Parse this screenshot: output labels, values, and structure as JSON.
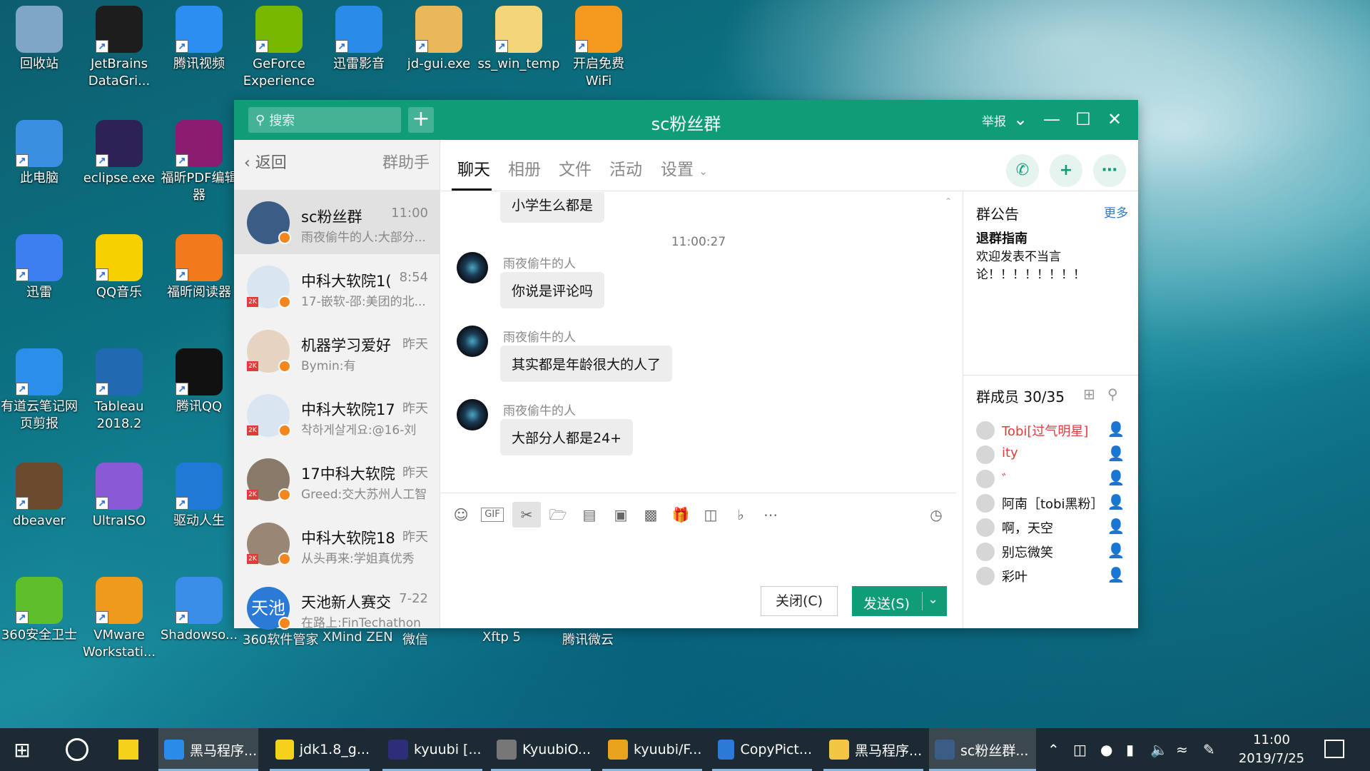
{
  "desktop": {
    "icons": [
      {
        "label": "回收站",
        "icon": "recycle-bin-icon",
        "color": "#7fa6c6"
      },
      {
        "label": "JetBrains DataGri...",
        "icon": "datagrip-icon",
        "color": "#1d1d1d"
      },
      {
        "label": "腾讯视频",
        "icon": "tencent-video-icon",
        "color": "#2b8ef0"
      },
      {
        "label": "GeForce Experience",
        "icon": "geforce-icon",
        "color": "#76b900"
      },
      {
        "label": "迅雷影音",
        "icon": "xunlei-player-icon",
        "color": "#2a8ce8"
      },
      {
        "label": "jd-gui.exe",
        "icon": "jd-gui-icon",
        "color": "#e9b85a"
      },
      {
        "label": "ss_win_temp",
        "icon": "folder-icon",
        "color": "#f3d57a"
      },
      {
        "label": "开启免费 WiFi",
        "icon": "wifi-icon",
        "color": "#f59a1c"
      },
      {
        "label": "此电脑",
        "icon": "this-pc-icon",
        "color": "#3a8fe0"
      },
      {
        "label": "eclipse.exe",
        "icon": "eclipse-icon",
        "color": "#2c2255"
      },
      {
        "label": "福昕PDF编辑器",
        "icon": "foxit-pdf-editor-icon",
        "color": "#8b1c6f"
      },
      {
        "label": "迅雷",
        "icon": "xunlei-icon",
        "color": "#3b7ff0"
      },
      {
        "label": "QQ音乐",
        "icon": "qq-music-icon",
        "color": "#f6d000"
      },
      {
        "label": "福昕阅读器",
        "icon": "foxit-reader-icon",
        "color": "#f07a1c"
      },
      {
        "label": "有道云笔记网 页剪报",
        "icon": "youdao-clipper-icon",
        "color": "#2a8fe8"
      },
      {
        "label": "Tableau 2018.2",
        "icon": "tableau-icon",
        "color": "#1f6ab0"
      },
      {
        "label": "腾讯QQ",
        "icon": "qq-penguin-icon",
        "color": "#111111"
      },
      {
        "label": "dbeaver",
        "icon": "dbeaver-icon",
        "color": "#6b4a2e"
      },
      {
        "label": "UltraISO",
        "icon": "ultraiso-icon",
        "color": "#8a5ad6"
      },
      {
        "label": "驱动人生",
        "icon": "driver-life-icon",
        "color": "#1f7ad6"
      },
      {
        "label": "360安全卫士",
        "icon": "360-safe-icon",
        "color": "#5fbf2a"
      },
      {
        "label": "VMware Workstati...",
        "icon": "vmware-icon",
        "color": "#f09a1c"
      },
      {
        "label": "Shadowso...",
        "icon": "shadowsocks-icon",
        "color": "#3a8ee8"
      }
    ],
    "hidden_labels": [
      "360软件管家",
      "XMind ZEN",
      "微信",
      "Xftp 5",
      "腾讯微云"
    ]
  },
  "window": {
    "title": "sc粉丝群",
    "search_placeholder": "搜索",
    "report": "举报",
    "back": "返回",
    "helper": "群助手",
    "tabs": [
      "聊天",
      "相册",
      "文件",
      "活动",
      "设置"
    ],
    "conversations": [
      {
        "name": "sc粉丝群",
        "time": "11:00",
        "preview": "雨夜偷牛的人:大部分...",
        "color": "#3b5c85",
        "badge": false
      },
      {
        "name": "中科大软院1(",
        "time": "8:54",
        "preview": "17-嵌软-邵:美团的北...",
        "color": "#d9e6f2",
        "badge": true
      },
      {
        "name": "机器学习爱好",
        "time": "昨天",
        "preview": "Bymin:有",
        "color": "#e6d3c0",
        "badge": true
      },
      {
        "name": "中科大软院17",
        "time": "昨天",
        "preview": "착하게살게요:@16-刘",
        "color": "#d9e6f2",
        "badge": true
      },
      {
        "name": "17中科大软院",
        "time": "昨天",
        "preview": "Greed:交大苏州人工智",
        "color": "#8a7a6a",
        "badge": true
      },
      {
        "name": "中科大软院18",
        "time": "昨天",
        "preview": "从头再来:学姐真优秀",
        "color": "#9a8674",
        "badge": true
      },
      {
        "name": "天池新人赛交",
        "time": "7-22",
        "preview": "在路上:FinTechathon",
        "color": "#2a7ad6",
        "badge": false,
        "avatar_text": "天池"
      }
    ],
    "messages": {
      "partial": "小学生么都是",
      "timestamp": "11:00:27",
      "items": [
        {
          "sender": "雨夜偷牛的人",
          "text": "你说是评论吗"
        },
        {
          "sender": "雨夜偷牛的人",
          "text": "其实都是年龄很大的人了"
        },
        {
          "sender": "雨夜偷牛的人",
          "text": "大部分人都是24+"
        }
      ]
    },
    "toolbar_icons": [
      "emoji-icon",
      "gif-icon",
      "scissors-icon",
      "folder-icon",
      "doc-icon",
      "image-icon",
      "screen-share-icon",
      "gift-icon",
      "red-packet-icon",
      "bell-off-icon",
      "more-icon"
    ],
    "history_icon": "clock-icon",
    "close_button": "关闭(C)",
    "send_button": "发送(S)",
    "notice": {
      "title": "群公告",
      "more": "更多",
      "heading": "退群指南",
      "body": "欢迎发表不当言论！！！！！！！！"
    },
    "members": {
      "title": "群成员 30/35",
      "list": [
        {
          "name": "Tobi[过气明星]",
          "red": true
        },
        {
          "name": "ity",
          "red": true
        },
        {
          "name": "゛",
          "red": true
        },
        {
          "name": "阿南［tobi黑粉］",
          "red": false
        },
        {
          "name": "啊，天空",
          "red": false
        },
        {
          "name": "别忘微笑",
          "red": false
        },
        {
          "name": "彩叶",
          "red": false
        }
      ]
    }
  },
  "taskbar": {
    "apps": [
      {
        "label": "黑马程序...",
        "color": "#2a8ce8"
      },
      {
        "label": "jdk1.8_g...",
        "color": "#f5d21a"
      },
      {
        "label": "kyuubi [...",
        "color": "#2d2d7a"
      },
      {
        "label": "KyuubiO...",
        "color": "#777777"
      },
      {
        "label": "kyuubi/F...",
        "color": "#e8a21c"
      },
      {
        "label": "CopyPict...",
        "color": "#2a7ad6"
      },
      {
        "label": "黑马程序...",
        "color": "#f3c545"
      },
      {
        "label": "sc粉丝群...",
        "color": "#3b5c85"
      }
    ],
    "time": "11:00",
    "date": "2019/7/25"
  }
}
